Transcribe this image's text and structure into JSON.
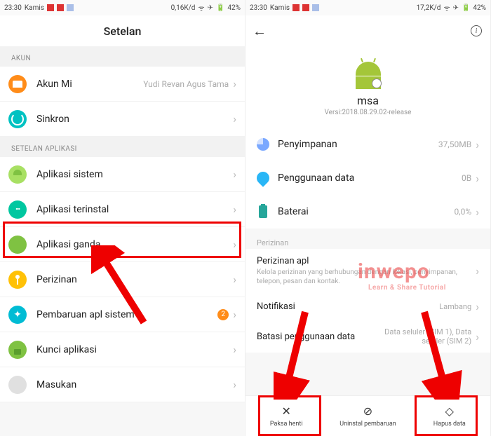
{
  "left": {
    "status": {
      "time": "23:30",
      "day": "Kamis",
      "speed": "0,16K/d",
      "batt": "42%"
    },
    "title": "Setelan",
    "section_akun": "AKUN",
    "akun_mi": "Akun Mi",
    "akun_mi_val": "Yudi Revan Agus Tama",
    "sinkron": "Sinkron",
    "section_app": "SETELAN APLIKASI",
    "items": {
      "sys": "Aplikasi sistem",
      "inst": "Aplikasi terinstal",
      "dual": "Aplikasi ganda",
      "perm": "Perizinan",
      "upd": "Pembaruan apl sistem",
      "upd_badge": "2",
      "lock": "Kunci aplikasi",
      "fb": "Masukan"
    }
  },
  "right": {
    "status": {
      "time": "23:30",
      "day": "Kamis",
      "speed": "17,2K/d",
      "batt": "42%"
    },
    "app_name": "msa",
    "app_version": "Versi:2018.08.29.02-release",
    "rows": {
      "storage": "Penyimpanan",
      "storage_val": "37,50MB",
      "data": "Penggunaan data",
      "data_val": "0B",
      "batt": "Baterai",
      "batt_val": "0,0%"
    },
    "perizinan_head": "Perizinan",
    "perm_apl": "Perizinan apl",
    "perm_apl_sub": "Kelola perizinan yang berhubungan dengan lokasi, penyimpanan, telepon, pesan dan kontak.",
    "notif": "Notifikasi",
    "notif_val": "Lambang",
    "restrict": "Batasi penggunaan data",
    "restrict_val": "Data seluler (SIM 1), Data seluler (SIM 2)",
    "bottom": {
      "force": "Paksa henti",
      "uninst": "Uninstal pembaruan",
      "clear": "Hapus data"
    }
  },
  "watermark": {
    "big": "inwepo",
    "small": "Learn & Share Tutorial"
  }
}
